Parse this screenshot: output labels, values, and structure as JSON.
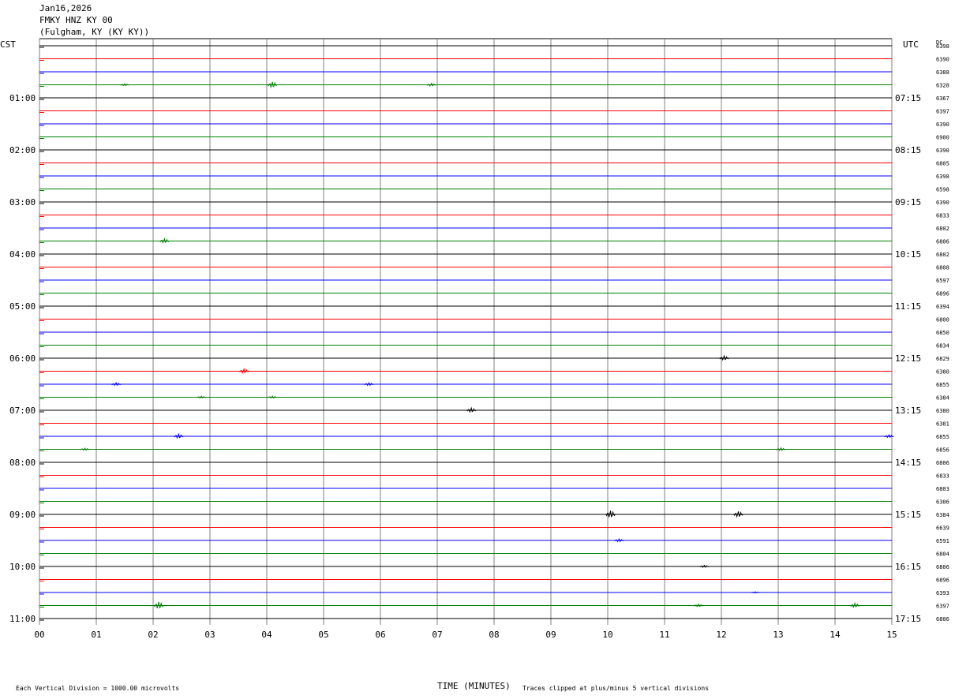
{
  "header": {
    "date": "Jan16,2026",
    "station": "FMKY HNZ KY 00",
    "location": "(Fulgham, KY (KY KY))"
  },
  "left_tz": "CST",
  "right_tz": "UTC",
  "dc_label": "DC",
  "footer": {
    "scale_note": "Each Vertical Division = 1000.00 microvolts",
    "x_title": "TIME (MINUTES)",
    "clip_note": "Traces clipped at plus/minus 5 vertical divisions"
  },
  "chart_data": {
    "type": "line",
    "title": "FMKY HNZ KY 00",
    "xlabel": "TIME (MINUTES)",
    "xlim": [
      0,
      15
    ],
    "x_ticks": [
      "00",
      "01",
      "02",
      "03",
      "04",
      "05",
      "06",
      "07",
      "08",
      "09",
      "10",
      "11",
      "12",
      "13",
      "14",
      "15"
    ],
    "rows_per_hour": 4,
    "row_minutes": 15,
    "trace_colors": [
      "#000000",
      "#ff0000",
      "#0000ff",
      "#008000"
    ],
    "grid_line_color": "#808080",
    "left_hour_labels": [
      "01:00",
      "02:00",
      "03:00",
      "04:00",
      "05:00",
      "06:00",
      "07:00",
      "08:00",
      "09:00",
      "10:00",
      "11:00"
    ],
    "right_hour_labels": [
      "07:15",
      "08:15",
      "09:15",
      "10:15",
      "11:15",
      "12:15",
      "13:15",
      "14:15",
      "15:15",
      "16:15",
      "17:15"
    ],
    "dc_offsets": [
      "6398",
      "6390",
      "6388",
      "6328",
      "6367",
      "6397",
      "6390",
      "6900",
      "6390",
      "6805",
      "6398",
      "6598",
      "6390",
      "6833",
      "6802",
      "6806",
      "6802",
      "6808",
      "6597",
      "6896",
      "6394",
      "6800",
      "6850",
      "6834",
      "6829",
      "6380",
      "6855",
      "6384",
      "6380",
      "6381",
      "6855",
      "6856",
      "6806",
      "6833",
      "6803",
      "6306",
      "6384",
      "6639",
      "6591",
      "6804",
      "6806",
      "6896",
      "6393",
      "6397",
      "6806"
    ],
    "events": [
      {
        "row": 3,
        "minute": 4.1,
        "amp": 4
      },
      {
        "row": 3,
        "minute": 6.9,
        "amp": 2
      },
      {
        "row": 3,
        "minute": 1.5,
        "amp": 1.5
      },
      {
        "row": 15,
        "minute": 2.2,
        "amp": 3
      },
      {
        "row": 24,
        "minute": 12.05,
        "amp": 3
      },
      {
        "row": 25,
        "minute": 3.6,
        "amp": 3
      },
      {
        "row": 26,
        "minute": 1.35,
        "amp": 2
      },
      {
        "row": 26,
        "minute": 5.8,
        "amp": 2
      },
      {
        "row": 27,
        "minute": 2.85,
        "amp": 1.5
      },
      {
        "row": 27,
        "minute": 4.1,
        "amp": 1.5
      },
      {
        "row": 28,
        "minute": 7.6,
        "amp": 3
      },
      {
        "row": 30,
        "minute": 2.45,
        "amp": 3
      },
      {
        "row": 30,
        "minute": 14.95,
        "amp": 2
      },
      {
        "row": 31,
        "minute": 0.8,
        "amp": 1.5
      },
      {
        "row": 31,
        "minute": 13.05,
        "amp": 2
      },
      {
        "row": 36,
        "minute": 10.05,
        "amp": 5
      },
      {
        "row": 36,
        "minute": 12.3,
        "amp": 4
      },
      {
        "row": 38,
        "minute": 10.2,
        "amp": 2
      },
      {
        "row": 40,
        "minute": 11.7,
        "amp": 1.5
      },
      {
        "row": 42,
        "minute": 12.6,
        "amp": 1
      },
      {
        "row": 43,
        "minute": 2.1,
        "amp": 5
      },
      {
        "row": 43,
        "minute": 11.6,
        "amp": 2
      },
      {
        "row": 43,
        "minute": 14.35,
        "amp": 3
      }
    ]
  }
}
